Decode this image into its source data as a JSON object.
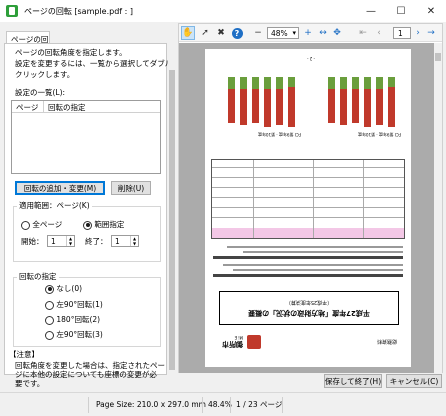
{
  "window": {
    "title": "ページの回転 [sample.pdf : ]",
    "minimize": "—",
    "maximize": "☐",
    "close": "✕"
  },
  "left_panel": {
    "tab_label": "ページの回転",
    "description": [
      "ページの回転角度を指定します。",
      "設定を変更するには、一覧から選択してダブル",
      "クリックします。"
    ],
    "list_label": "設定の一覧(L):",
    "list_columns": [
      "ページ",
      "回転の指定"
    ],
    "add_change_button": "回転の追加・変更(M)",
    "delete_button": "削除(U)",
    "scope_label": "適用範囲：ページ(K)",
    "all_pages": "全ページ",
    "range": "範囲指定",
    "start_label": "開始：",
    "start_value": "1",
    "end_label": "終了：",
    "end_value": "1",
    "rotation_label": "回転の指定",
    "rotation_options": [
      "なし(0)",
      "左90°回転(1)",
      "180°回転(2)",
      "左90°回転(3)"
    ],
    "note_title": "【注意】",
    "note_lines": [
      "回転角度を変更した場合は、指定されたペー",
      "ジに本他の設定についても座標の変更が必",
      "要です。"
    ]
  },
  "toolbar": {
    "hand": "✋",
    "pointer": "➚",
    "delete": "✖",
    "help": "?",
    "zoom_out": "−",
    "zoom_value": "48%",
    "zoom_dropdown": "▾",
    "zoom_in": "+",
    "fit_width": "↔",
    "fit_page": "✥",
    "first": "⇤",
    "prev": "‹",
    "page_value": "1",
    "next": "›",
    "go": "→"
  },
  "page_content": {
    "page_marker": "- 2 -",
    "chart_label_left": "FCI 第9年度 · 第10年度",
    "chart_label_right": "FCI 第9年度 · 第10年度",
    "heading_banner": "平成27年度「地方財政の状況」の概要",
    "heading_sub": "（平成25年度決算）",
    "company": "御所市",
    "company_en": "Mi E",
    "footer_label": "総務資料"
  },
  "status": {
    "page_size": "Page Size: 210.0 x 297.0 mm",
    "zoom": "48.4%",
    "pages": "1 / 23 ページ"
  },
  "buttons": {
    "save_close": "保存して終了(H)",
    "cancel": "キャンセル(C)"
  }
}
